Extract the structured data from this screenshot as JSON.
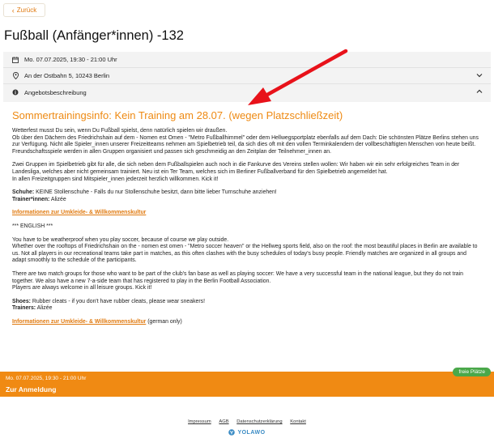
{
  "nav": {
    "back_label": "Zurück"
  },
  "page": {
    "title": "Fußball (Anfänger*innen) -132"
  },
  "info": {
    "datetime": "Mo. 07.07.2025, 19:30 - 21:00 Uhr",
    "address": "An der Ostbahn 5, 10243 Berlin",
    "description_label": "Angebotsbeschreibung"
  },
  "description": {
    "headline": "Sommertrainingsinfo: Kein Training am 28.07. (wegen Platzschließzeit)",
    "de_p1": "Wetterfest musst Du sein, wenn Du Fußball spielst, denn natürlich spielen wir draußen.",
    "de_p2": " Ob über den Dächern des Friedrichshain auf dem - Nomen est Omen - \"Metro Fußballhimmel\" oder dem Hellwegsportplatz ebenfalls auf dem Dach: Die schönsten Plätze Berlins stehen uns zur Verfügung. Nicht alle Spieler_innen unserer Freizeitteams nehmen am Spielbetrieb teil, da sich dies oft mit den vollen Terminkalendern der vollbeschäftigten Menschen von heute beißt. Freundschaftsspiele werden in allen Gruppen organisiert und passen sich geschmeidig an den Zeitplan der Teilnehmer_innen an.",
    "de_p3": "Zwei Gruppen im Spielbetrieb gibt für alle, die sich neben dem Fußballspielen auch noch in die Fankurve des Vereins stellen wollen: Wir haben wir ein sehr erfolgreiches Team in der Landesliga, welches aber nicht gemeinsam trainiert. Neu ist ein Ter Team, welches sich im Berliner Fußballverband für den Spielbetrieb angemeldet hat.",
    "de_p4": "In allen Freizeitgruppen sind Mitspieler_innen jederzeit herzlich willkommen. Kick it!",
    "shoes_label": "Schuhe:",
    "shoes_text": " KEINE Stollenschuhe - Falls du nur Stollenschuhe besitzt, dann bitte lieber Turnschuhe anziehen!",
    "trainer_label": " Trainer*innen:",
    "trainer_text": " Alizée",
    "link_de": "Informationen zur Umkleide- & Willkommenskultur",
    "english_marker": "*** ENGLISH ***",
    "en_p1": "You have to be weatherproof when you play soccer, because of course we play outside.",
    "en_p2": "Whether over the rooftops of Friedrichshain on the - nomen est omen - \"Metro soccer heaven\" or the Hellweg sports field, also on the roof: the most beautiful places in Berlin are available to us. Not all players in our recreational teams take part in matches, as this often clashes with the busy schedules of today's busy people. Friendly matches are organized in all groups and adapt smoothly to the schedule of the participants.",
    "en_p3": "There are two match groups for those who want to be part of the club's fan base as well as playing soccer: We have a very successful team in the national league, but they do not train together. We also have a new 7-a-side team that has registered to play in the Berlin Football Association.",
    "en_p4": "Players are always welcome in all leisure groups. Kick it!",
    "shoes_label_en": "Shoes:",
    "shoes_text_en": " Rubber cleats - if you don't have rubber cleats, please wear sneakers!",
    "trainers_label_en": "Trainers:",
    "trainers_text_en": " Alizée",
    "link_en": "Informationen zur Umkleide- & Willkommenskultur",
    "link_en_suffix": " (german only)"
  },
  "cta": {
    "datetime": "Mo. 07.07.2025, 19:30 - 21:00 Uhr",
    "label": "Zur Anmeldung",
    "badge": "freie Plätze"
  },
  "footer": {
    "links": [
      "Impressum",
      "AGB",
      "Datenschutzerklärung",
      "Kontakt"
    ],
    "brand": "YOLAWO"
  },
  "colors": {
    "accent": "#ee8a13",
    "badge": "#4aa84a",
    "arrow": "#e8121a",
    "brand": "#3a8bc4"
  }
}
